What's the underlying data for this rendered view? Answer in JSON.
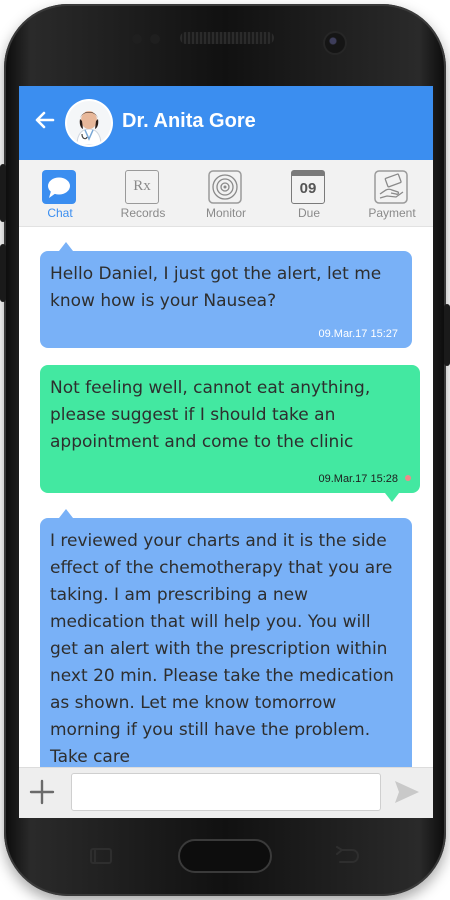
{
  "header": {
    "title": "Dr. Anita Gore",
    "back_icon": "back-arrow-icon",
    "avatar_icon": "doctor-avatar"
  },
  "tabs": [
    {
      "label": "Chat",
      "icon": "chat-bubble-icon",
      "active": true
    },
    {
      "label": "Records",
      "icon": "rx-icon",
      "active": false
    },
    {
      "label": "Monitor",
      "icon": "target-icon",
      "active": false
    },
    {
      "label": "Due",
      "icon": "calendar-icon",
      "icon_text": "09",
      "active": false
    },
    {
      "label": "Payment",
      "icon": "payment-hand-icon",
      "active": false
    }
  ],
  "rx_icon_text": "Rx",
  "messages": [
    {
      "sender": "doctor",
      "text": "Hello Daniel, I just got the alert, let me know how is your Nausea?",
      "timestamp": "09.Mar.17 15:27"
    },
    {
      "sender": "patient",
      "text": "Not feeling well, cannot eat anything, please suggest if I should take an appointment and come to the clinic",
      "timestamp": "09.Mar.17 15:28"
    },
    {
      "sender": "doctor",
      "text": "I reviewed your charts and it is the side effect of the chemotherapy that you are taking. I am prescribing a new medication that will help you. You will get an alert with the prescription within next 20 min. Please take the medication as shown. Let me know tomorrow morning if you still have the problem. Take care",
      "timestamp": ""
    }
  ],
  "composer": {
    "plus_icon": "plus-icon",
    "input_value": "",
    "placeholder": "",
    "send_icon": "send-icon"
  },
  "colors": {
    "header_blue": "#3b8ef0",
    "doctor_bubble": "#79b1f7",
    "patient_bubble": "#43e8a1",
    "tab_active": "#3b8ef0",
    "tab_inactive": "#8a8a8a"
  }
}
